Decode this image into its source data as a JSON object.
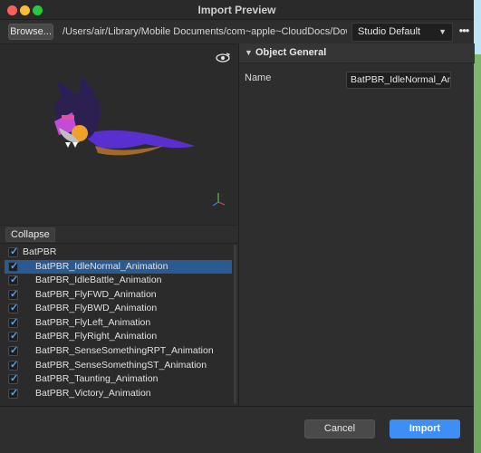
{
  "window": {
    "title": "Import Preview"
  },
  "toolbar": {
    "browse_label": "Browse...",
    "path": "/Users/air/Library/Mobile Documents/com~apple~CloudDocs/Downloads/BatP",
    "preset": "Studio Default",
    "more_label": "•••"
  },
  "preview": {
    "rotate_icon": "orbit-rotate-icon",
    "axis_icon": "axis-gizmo-icon"
  },
  "collapse_label": "Collapse",
  "tree": {
    "root": {
      "label": "BatPBR",
      "checked": true
    },
    "items": [
      {
        "label": "BatPBR_IdleNormal_Animation",
        "checked": true,
        "selected": true
      },
      {
        "label": "BatPBR_IdleBattle_Animation",
        "checked": true
      },
      {
        "label": "BatPBR_FlyFWD_Animation",
        "checked": true
      },
      {
        "label": "BatPBR_FlyBWD_Animation",
        "checked": true
      },
      {
        "label": "BatPBR_FlyLeft_Animation",
        "checked": true
      },
      {
        "label": "BatPBR_FlyRight_Animation",
        "checked": true
      },
      {
        "label": "BatPBR_SenseSomethingRPT_Animation",
        "checked": true
      },
      {
        "label": "BatPBR_SenseSomethingST_Animation",
        "checked": true
      },
      {
        "label": "BatPBR_Taunting_Animation",
        "checked": true
      },
      {
        "label": "BatPBR_Victory_Animation",
        "checked": true
      }
    ]
  },
  "properties": {
    "section_title": "Object General",
    "name_label": "Name",
    "name_value": "BatPBR_IdleNormal_Animation"
  },
  "footer": {
    "cancel_label": "Cancel",
    "import_label": "Import"
  },
  "colors": {
    "accent": "#3d8ff6",
    "selection": "#2a5a8f",
    "check": "#4aa7ff"
  }
}
